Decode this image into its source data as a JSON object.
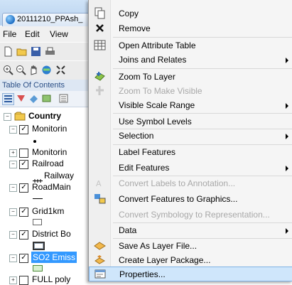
{
  "window": {
    "tab_title": "20111210_PPAsh_"
  },
  "menubar": {
    "file": "File",
    "edit": "Edit",
    "view": "View"
  },
  "toc": {
    "title": "Table Of Contents",
    "group": "Country",
    "layers": [
      {
        "label": "Monitorin",
        "checked": true,
        "expanded": true
      },
      {
        "label": "Monitorin",
        "checked": false,
        "expanded": false
      },
      {
        "label": "Railroad",
        "checked": true,
        "expanded": true,
        "legend": "Railway"
      },
      {
        "label": "RoadMain",
        "checked": true,
        "expanded": true
      },
      {
        "label": "Grid1km",
        "checked": true,
        "expanded": true
      },
      {
        "label": "District Bo",
        "checked": true,
        "expanded": true
      },
      {
        "label": "SO2 Emiss",
        "checked": true,
        "expanded": true,
        "selected": true
      },
      {
        "label": "FULL poly",
        "checked": false,
        "expanded": false
      }
    ]
  },
  "context_menu": {
    "items": [
      {
        "label": "Copy",
        "icon": "copy-icon",
        "disabled": false,
        "submenu": false
      },
      {
        "label": "Remove",
        "icon": "remove-icon",
        "disabled": false,
        "submenu": false
      },
      {
        "label": "Open Attribute Table",
        "icon": "table-icon",
        "disabled": false,
        "submenu": false
      },
      {
        "label": "Joins and Relates",
        "icon": "",
        "disabled": false,
        "submenu": true
      },
      {
        "label": "Zoom To Layer",
        "icon": "zoom-to-layer-icon",
        "disabled": false,
        "submenu": false
      },
      {
        "label": "Zoom To Make Visible",
        "icon": "zoom-visible-icon",
        "disabled": true,
        "submenu": false
      },
      {
        "label": "Visible Scale Range",
        "icon": "",
        "disabled": false,
        "submenu": true
      },
      {
        "label": "Use Symbol Levels",
        "icon": "",
        "disabled": false,
        "submenu": false
      },
      {
        "label": "Selection",
        "icon": "",
        "disabled": false,
        "submenu": true
      },
      {
        "label": "Label Features",
        "icon": "",
        "disabled": false,
        "submenu": false
      },
      {
        "label": "Edit Features",
        "icon": "",
        "disabled": false,
        "submenu": true
      },
      {
        "label": "Convert Labels to Annotation...",
        "icon": "convert-labels-icon",
        "disabled": true,
        "submenu": false
      },
      {
        "label": "Convert Features to Graphics...",
        "icon": "convert-features-icon",
        "disabled": false,
        "submenu": false
      },
      {
        "label": "Convert Symbology to Representation...",
        "icon": "",
        "disabled": true,
        "submenu": false
      },
      {
        "label": "Data",
        "icon": "",
        "disabled": false,
        "submenu": true
      },
      {
        "label": "Save As Layer File...",
        "icon": "save-layer-icon",
        "disabled": false,
        "submenu": false
      },
      {
        "label": "Create Layer Package...",
        "icon": "layer-package-icon",
        "disabled": false,
        "submenu": false
      },
      {
        "label": "Properties...",
        "icon": "properties-icon",
        "disabled": false,
        "submenu": false,
        "highlighted": true
      }
    ]
  }
}
